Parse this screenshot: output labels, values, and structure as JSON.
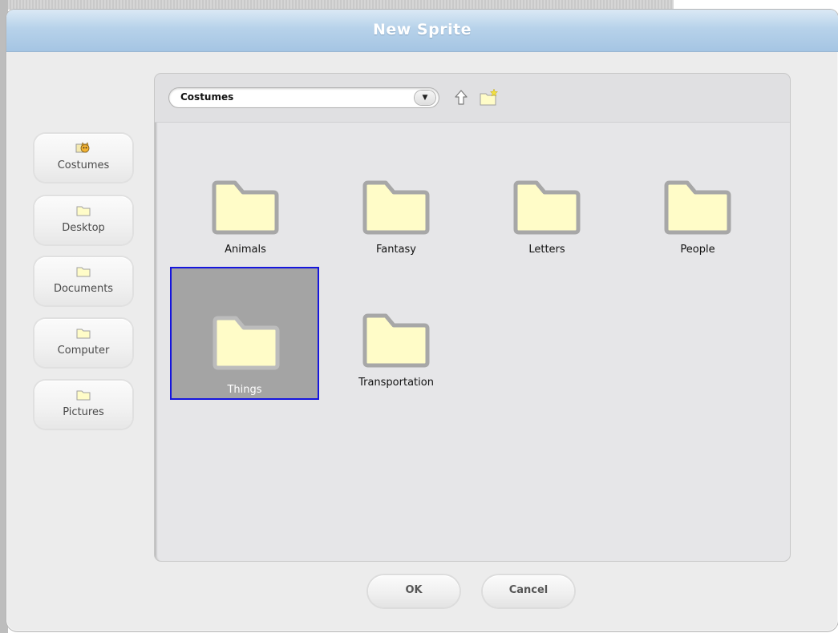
{
  "dialog": {
    "title": "New Sprite"
  },
  "sidebar": {
    "items": [
      {
        "label": "Costumes",
        "icon": "scratch-cat-icon"
      },
      {
        "label": "Desktop",
        "icon": "folder-icon"
      },
      {
        "label": "Documents",
        "icon": "folder-icon"
      },
      {
        "label": "Computer",
        "icon": "folder-icon"
      },
      {
        "label": "Pictures",
        "icon": "folder-icon"
      }
    ]
  },
  "toolbar": {
    "path_value": "Costumes",
    "up_icon": "up-arrow-icon",
    "new_folder_icon": "new-folder-icon"
  },
  "folders": [
    {
      "name": "Animals",
      "selected": false
    },
    {
      "name": "Fantasy",
      "selected": false
    },
    {
      "name": "Letters",
      "selected": false
    },
    {
      "name": "People",
      "selected": false
    },
    {
      "name": "Things",
      "selected": true
    },
    {
      "name": "Transportation",
      "selected": false
    }
  ],
  "buttons": {
    "ok_label": "OK",
    "cancel_label": "Cancel"
  },
  "colors": {
    "folder_fill": "#fffcc8",
    "folder_outline": "#a7a7a7",
    "selection_border": "#1515dd",
    "titlebar": "#a5c5e3"
  }
}
